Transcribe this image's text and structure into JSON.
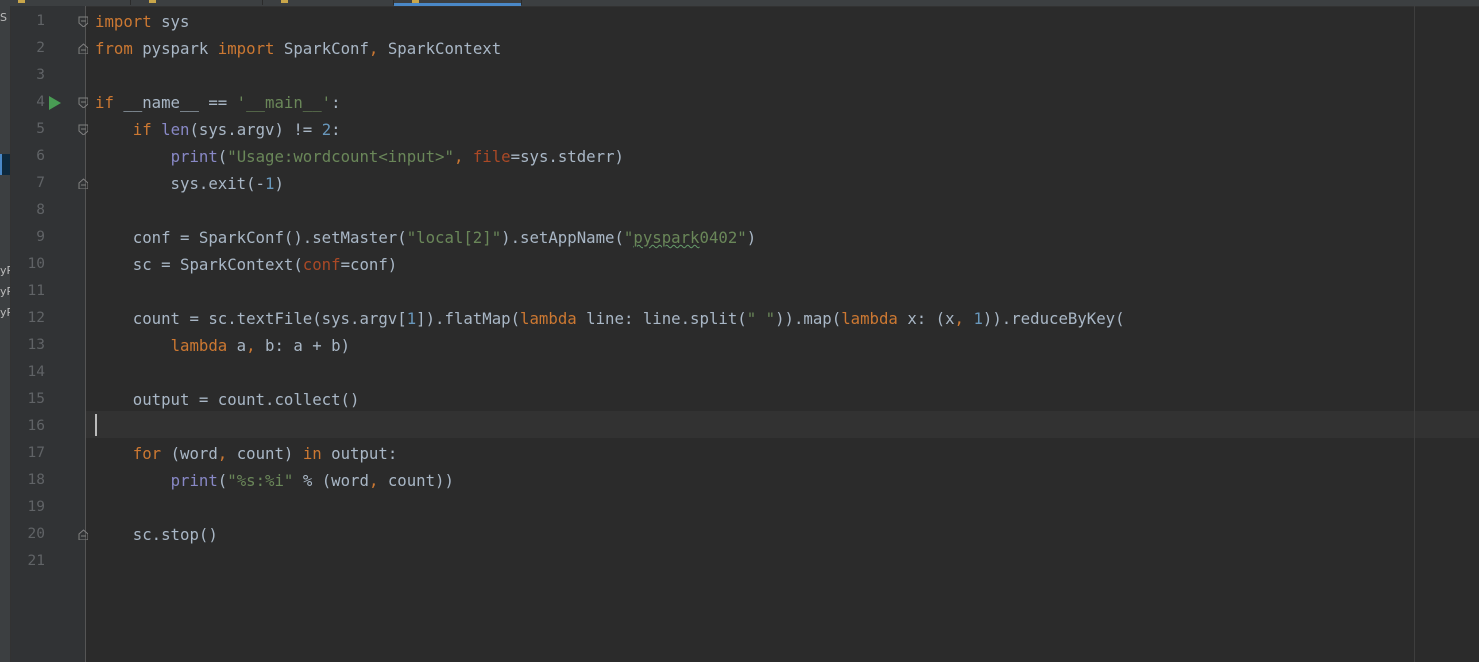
{
  "side_panel": {
    "labels": [
      "S",
      "yP",
      "yP",
      "yP"
    ]
  },
  "colors": {
    "background": "#2b2b2b",
    "keyword": "#cc7832",
    "string": "#6a8759",
    "number": "#6897bb",
    "builtin": "#8888c6",
    "param": "#aa4926",
    "text": "#a9b7c6",
    "line_number": "#606366",
    "active_tab": "#4a88c7",
    "run_icon": "#499c54"
  },
  "editor": {
    "line_numbers": [
      "1",
      "2",
      "3",
      "4",
      "5",
      "6",
      "7",
      "8",
      "9",
      "10",
      "11",
      "12",
      "13",
      "14",
      "15",
      "16",
      "17",
      "18",
      "19",
      "20",
      "21"
    ],
    "current_line": 16,
    "run_icon_line": 4,
    "lines": [
      [
        {
          "t": "kw",
          "v": "import"
        },
        {
          "t": "tx",
          "v": " sys"
        }
      ],
      [
        {
          "t": "kw",
          "v": "from"
        },
        {
          "t": "tx",
          "v": " pyspark "
        },
        {
          "t": "kw",
          "v": "import"
        },
        {
          "t": "tx",
          "v": " SparkConf"
        },
        {
          "t": "kw",
          "v": ","
        },
        {
          "t": "tx",
          "v": " SparkContext"
        }
      ],
      [],
      [
        {
          "t": "kw",
          "v": "if"
        },
        {
          "t": "tx",
          "v": " __name__ == "
        },
        {
          "t": "str",
          "v": "'__main__'"
        },
        {
          "t": "tx",
          "v": ":"
        }
      ],
      [
        {
          "t": "tx",
          "v": "    "
        },
        {
          "t": "kw",
          "v": "if"
        },
        {
          "t": "tx",
          "v": " "
        },
        {
          "t": "bi",
          "v": "len"
        },
        {
          "t": "tx",
          "v": "(sys.argv) != "
        },
        {
          "t": "num",
          "v": "2"
        },
        {
          "t": "tx",
          "v": ":"
        }
      ],
      [
        {
          "t": "tx",
          "v": "        "
        },
        {
          "t": "bi",
          "v": "print"
        },
        {
          "t": "tx",
          "v": "("
        },
        {
          "t": "str",
          "v": "\"Usage:wordcount<input>\""
        },
        {
          "t": "kw",
          "v": ","
        },
        {
          "t": "tx",
          "v": " "
        },
        {
          "t": "param",
          "v": "file"
        },
        {
          "t": "tx",
          "v": "=sys.stderr)"
        }
      ],
      [
        {
          "t": "tx",
          "v": "        sys.exit(-"
        },
        {
          "t": "num",
          "v": "1"
        },
        {
          "t": "tx",
          "v": ")"
        }
      ],
      [],
      [
        {
          "t": "tx",
          "v": "    conf = SparkConf().setMaster("
        },
        {
          "t": "str",
          "v": "\"local[2]\""
        },
        {
          "t": "tx",
          "v": ").setAppName("
        },
        {
          "t": "str",
          "v": "\""
        },
        {
          "t": "strtypo",
          "v": "pyspark"
        },
        {
          "t": "str",
          "v": "0402\""
        },
        {
          "t": "tx",
          "v": ")"
        }
      ],
      [
        {
          "t": "tx",
          "v": "    sc = SparkContext("
        },
        {
          "t": "param",
          "v": "conf"
        },
        {
          "t": "tx",
          "v": "=conf)"
        }
      ],
      [],
      [
        {
          "t": "tx",
          "v": "    count = sc.textFile(sys.argv["
        },
        {
          "t": "num",
          "v": "1"
        },
        {
          "t": "tx",
          "v": "]).flatMap("
        },
        {
          "t": "kw",
          "v": "lambda"
        },
        {
          "t": "tx",
          "v": " line: line.split("
        },
        {
          "t": "str",
          "v": "\" \""
        },
        {
          "t": "tx",
          "v": ")).map("
        },
        {
          "t": "kw",
          "v": "lambda"
        },
        {
          "t": "tx",
          "v": " x: (x"
        },
        {
          "t": "kw",
          "v": ","
        },
        {
          "t": "tx",
          "v": " "
        },
        {
          "t": "num",
          "v": "1"
        },
        {
          "t": "tx",
          "v": ")).reduceByKey("
        }
      ],
      [
        {
          "t": "tx",
          "v": "        "
        },
        {
          "t": "kw",
          "v": "lambda"
        },
        {
          "t": "tx",
          "v": " a"
        },
        {
          "t": "kw",
          "v": ","
        },
        {
          "t": "tx",
          "v": " b: a + b)"
        }
      ],
      [],
      [
        {
          "t": "tx",
          "v": "    output = count.collect()"
        }
      ],
      [],
      [
        {
          "t": "tx",
          "v": "    "
        },
        {
          "t": "kw",
          "v": "for"
        },
        {
          "t": "tx",
          "v": " (word"
        },
        {
          "t": "kw",
          "v": ","
        },
        {
          "t": "tx",
          "v": " count) "
        },
        {
          "t": "kw",
          "v": "in"
        },
        {
          "t": "tx",
          "v": " output:"
        }
      ],
      [
        {
          "t": "tx",
          "v": "        "
        },
        {
          "t": "bi",
          "v": "print"
        },
        {
          "t": "tx",
          "v": "("
        },
        {
          "t": "str",
          "v": "\"%s:%i\""
        },
        {
          "t": "tx",
          "v": " % (word"
        },
        {
          "t": "kw",
          "v": ","
        },
        {
          "t": "tx",
          "v": " count))"
        }
      ],
      [],
      [
        {
          "t": "tx",
          "v": "    sc.stop()"
        }
      ],
      []
    ]
  },
  "gutter_icons": {
    "fold_open": "fold-open-icon",
    "fold_end": "fold-end-icon",
    "run": "run-icon"
  }
}
